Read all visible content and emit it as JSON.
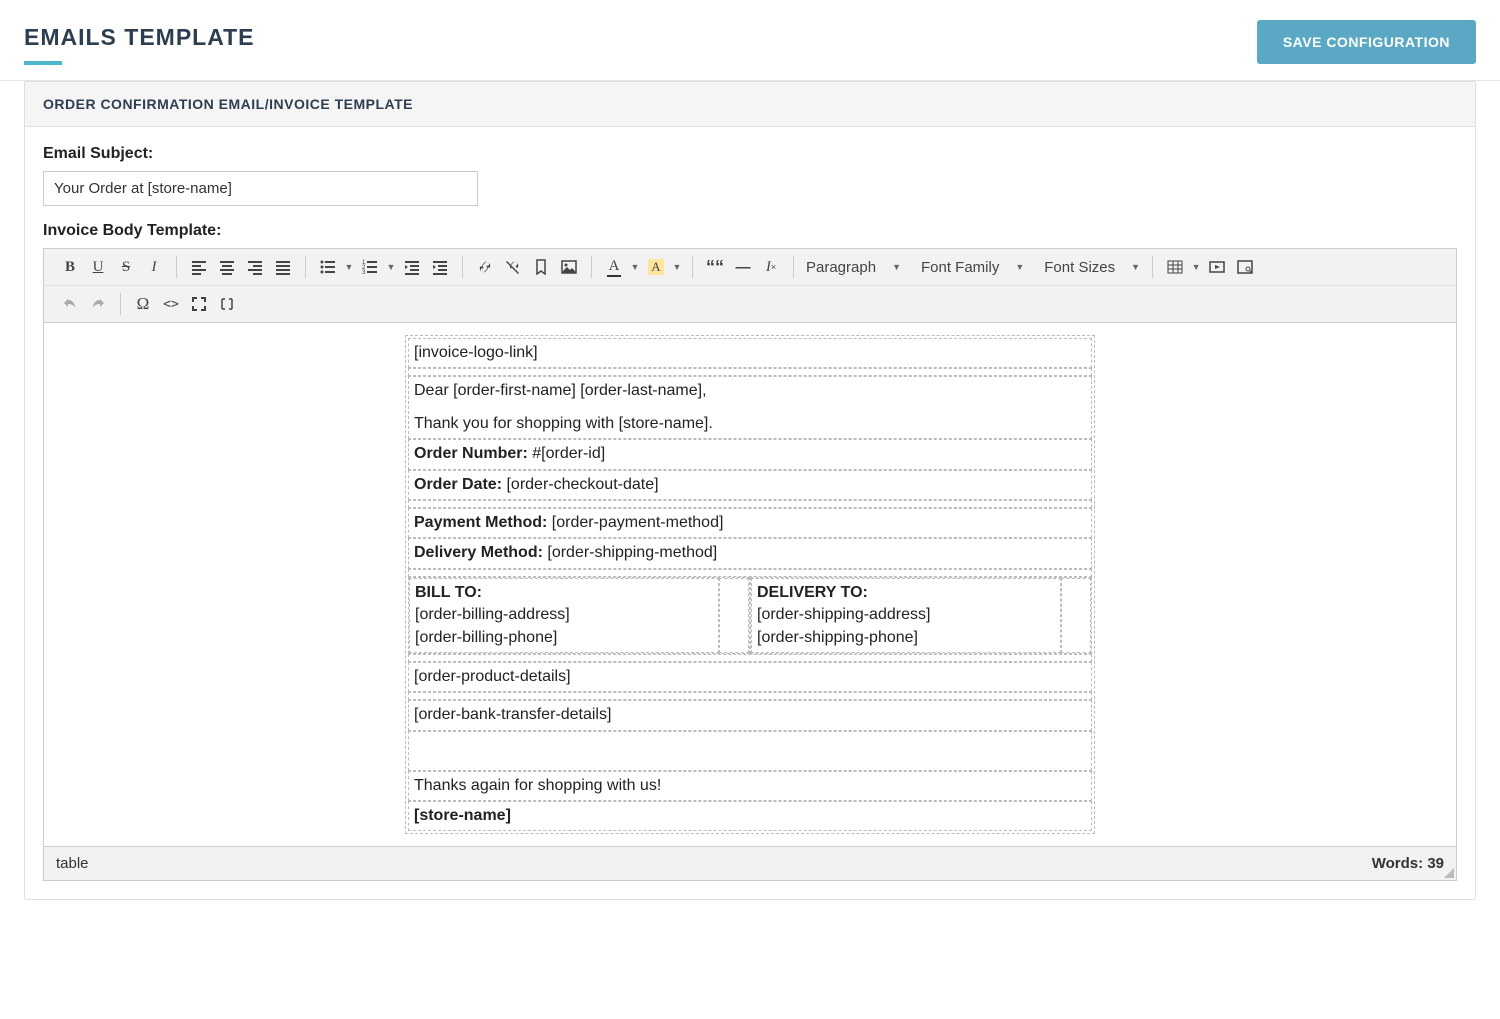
{
  "header": {
    "title": "EMAILS TEMPLATE",
    "save_label": "SAVE CONFIGURATION"
  },
  "panel": {
    "title": "ORDER CONFIRMATION EMAIL/INVOICE TEMPLATE"
  },
  "form": {
    "email_subject_label": "Email Subject:",
    "email_subject_value": "Your Order at [store-name]",
    "body_label": "Invoice Body Template:"
  },
  "toolbar": {
    "paragraph": "Paragraph",
    "font_family": "Font Family",
    "font_sizes": "Font Sizes"
  },
  "template": {
    "logo": "[invoice-logo-link]",
    "greeting": "Dear [order-first-name] [order-last-name],",
    "thanks_line": "Thank you for shopping with [store-name].",
    "order_number_label": "Order Number:",
    "order_number_value": " #[order-id]",
    "order_date_label": "Order Date:",
    "order_date_value": " [order-checkout-date]",
    "payment_label": "Payment Method:",
    "payment_value": " [order-payment-method]",
    "delivery_label": "Delivery Method:",
    "delivery_value": " [order-shipping-method]",
    "bill_to_label": "BILL TO:",
    "bill_address": "[order-billing-address]",
    "bill_phone": "[order-billing-phone]",
    "deliver_to_label": "DELIVERY TO:",
    "ship_address": "[order-shipping-address]",
    "ship_phone": "[order-shipping-phone]",
    "product_details": "[order-product-details]",
    "bank_details": "[order-bank-transfer-details]",
    "thanks_again": "Thanks again for shopping with us!",
    "store_sign": "[store-name]"
  },
  "statusbar": {
    "path": "table",
    "words_label": "Words: ",
    "words_count": "39"
  }
}
